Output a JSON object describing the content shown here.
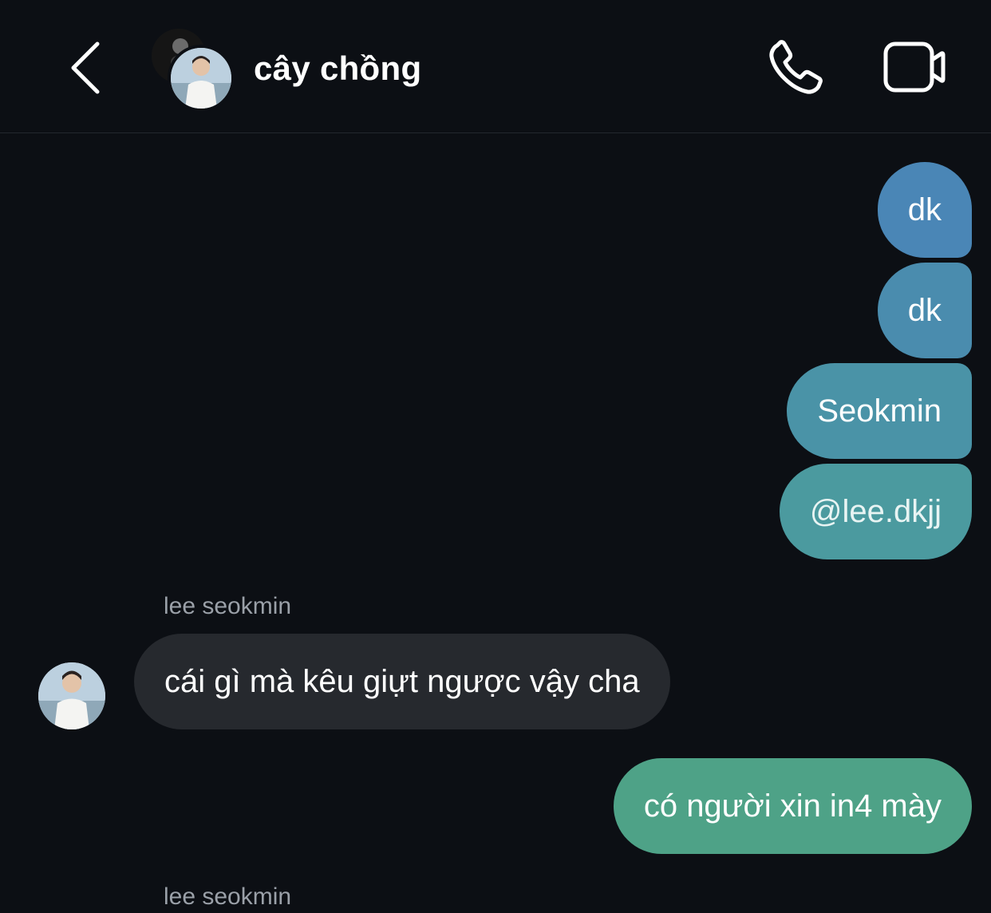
{
  "header": {
    "title": "cây chồng",
    "back_icon": "chevron-left-icon",
    "call_icon": "phone-icon",
    "video_icon": "video-camera-icon"
  },
  "messages": [
    {
      "direction": "outgoing",
      "text": "dk"
    },
    {
      "direction": "outgoing",
      "text": "dk"
    },
    {
      "direction": "outgoing",
      "text": "Seokmin"
    },
    {
      "direction": "outgoing",
      "text": "@lee.dkjj"
    },
    {
      "direction": "incoming",
      "sender": "lee seokmin",
      "text": "cái gì mà kêu giựt ngược vậy cha"
    },
    {
      "direction": "outgoing",
      "text": "có người xin in4 mày"
    }
  ],
  "next_sender": "lee seokmin",
  "colors": {
    "background": "#0c0f14",
    "incoming_bubble": "#26292e",
    "outgoing_gradient_top": "#4a86b6",
    "outgoing_gradient_bottom": "#4ea287"
  }
}
